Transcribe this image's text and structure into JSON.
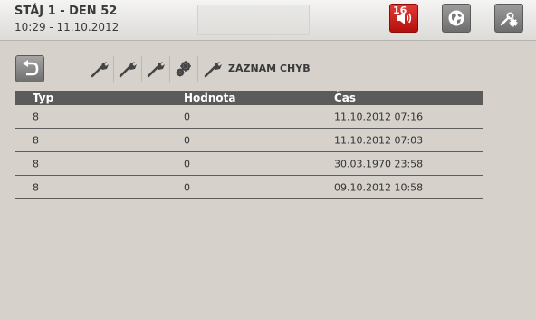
{
  "header": {
    "title": "STÁJ 1 - DEN 52",
    "subtitle": "10:29 - 11.10.2012",
    "alarm_count": "16"
  },
  "colors": {
    "alarm_red": "#c91f1b",
    "table_header": "#5b5b5b",
    "background": "#d6d2cb"
  },
  "icons": {
    "alarm": "speaker-icon",
    "network": "globe-icon",
    "settings": "tools-gear-icon",
    "back": "back-arrow-icon",
    "tools": [
      "wrench-icon",
      "wrench-icon",
      "wrench-icon",
      "gears-icon",
      "wrench-icon"
    ]
  },
  "section": {
    "title": "ZÁZNAM CHYB"
  },
  "table": {
    "columns": [
      "Typ",
      "Hodnota",
      "Čas"
    ],
    "rows": [
      [
        "8",
        "0",
        "11.10.2012 07:16"
      ],
      [
        "8",
        "0",
        "11.10.2012 07:03"
      ],
      [
        "8",
        "0",
        "30.03.1970 23:58"
      ],
      [
        "8",
        "0",
        "09.10.2012 10:58"
      ]
    ]
  }
}
